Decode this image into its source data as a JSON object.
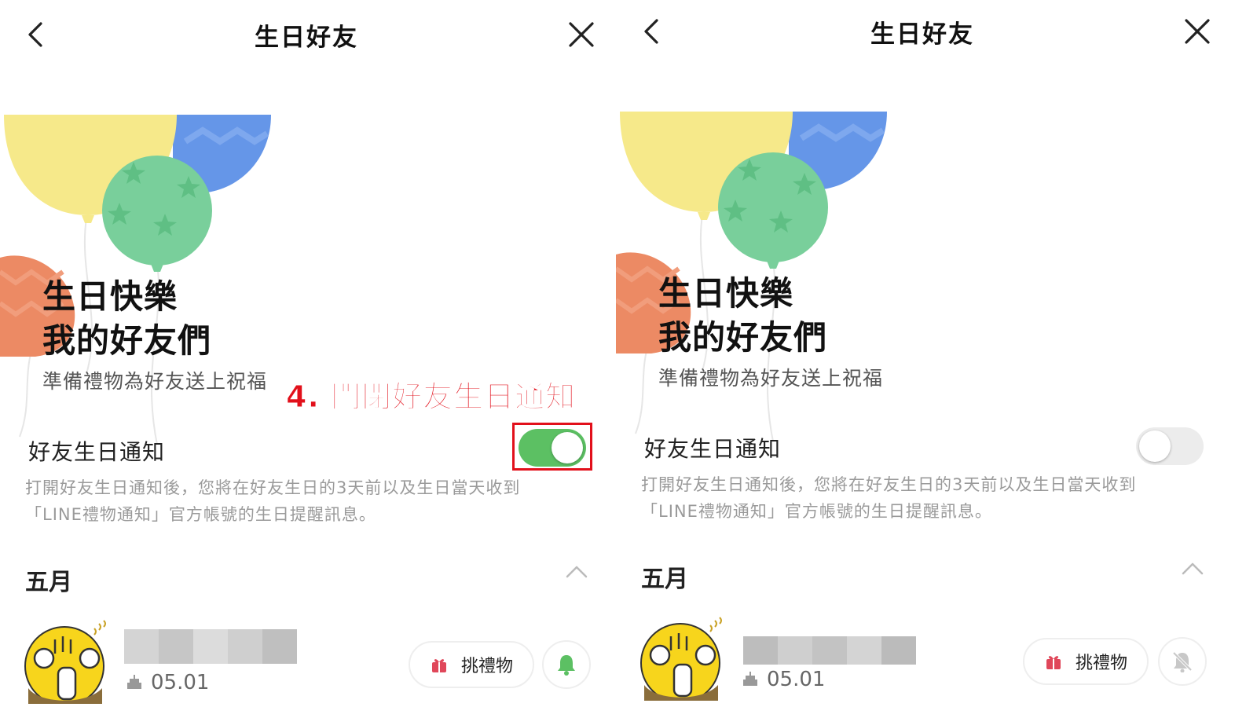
{
  "header": {
    "title": "生日好友"
  },
  "hero": {
    "title_line1": "生日快樂",
    "title_line2": "我的好友們",
    "subtitle": "準備禮物為好友送上祝福"
  },
  "notification": {
    "label": "好友生日通知",
    "desc_line1": "打開好友生日通知後，您將在好友生日的3天前以及生日當天收到",
    "desc_line2": "「LINE禮物通知」官方帳號的生日提醒訊息。"
  },
  "annotation": "4. 關閉好友生日通知",
  "month": {
    "label": "五月"
  },
  "friend": {
    "birthday": "05.01",
    "gift_label": "挑禮物"
  },
  "panels": [
    {
      "toggle_on": true,
      "bell": "bell-icon"
    },
    {
      "toggle_on": false,
      "bell": "bell-muted-icon"
    }
  ],
  "colors": {
    "toggle_on": "#5cc063",
    "annotation": "#e2101b",
    "balloon_yellow": "#f6e98a",
    "balloon_blue": "#6596e8",
    "balloon_green": "#79cf9b",
    "balloon_orange": "#ec8a64"
  }
}
